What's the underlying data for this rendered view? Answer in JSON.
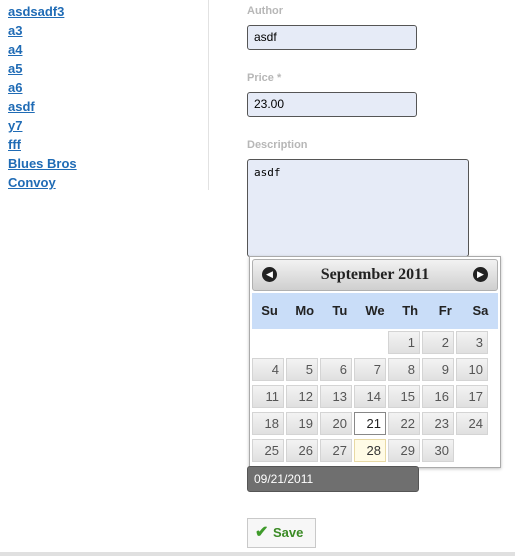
{
  "links": [
    "asdsadf3",
    "a3",
    "a4",
    "a5",
    "a6",
    "asdf",
    "y7",
    "fff",
    "Blues Bros",
    "Convoy"
  ],
  "form": {
    "author_label": "Author",
    "author_value": "asdf",
    "price_label": "Price *",
    "price_value": "23.00",
    "description_label": "Description",
    "description_value": "asdf",
    "date_value": "09/21/2011",
    "save_label": "Save"
  },
  "datepicker": {
    "title": "September 2011",
    "weekdays": [
      "Su",
      "Mo",
      "Tu",
      "We",
      "Th",
      "Fr",
      "Sa"
    ],
    "weeks": [
      [
        "",
        "",
        "",
        "",
        "1",
        "2",
        "3"
      ],
      [
        "4",
        "5",
        "6",
        "7",
        "8",
        "9",
        "10"
      ],
      [
        "11",
        "12",
        "13",
        "14",
        "15",
        "16",
        "17"
      ],
      [
        "18",
        "19",
        "20",
        "21",
        "22",
        "23",
        "24"
      ],
      [
        "25",
        "26",
        "27",
        "28",
        "29",
        "30",
        ""
      ]
    ],
    "highlighted_day": "21",
    "active_day": "28"
  },
  "colors": {
    "link": "#1f6bb5",
    "save_text": "#3a8a24",
    "week_header_bg": "#c9ddf8"
  },
  "icons": {
    "prev": "circle-arrow-left-icon",
    "next": "circle-arrow-right-icon",
    "save": "checkmark-icon"
  }
}
